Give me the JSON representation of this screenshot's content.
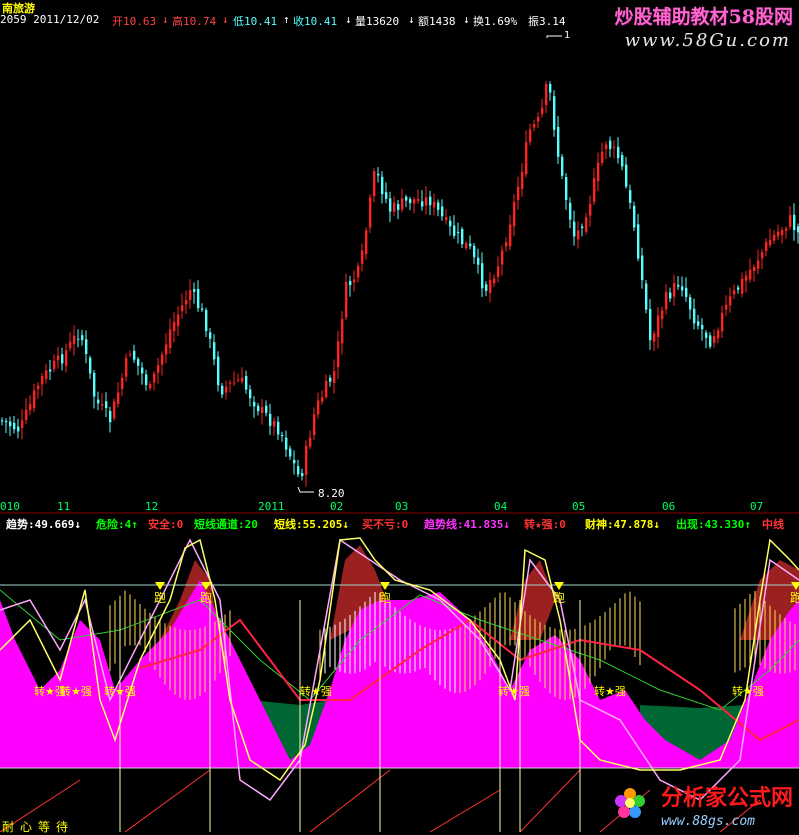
{
  "header": {
    "stock_name": "南旅游",
    "code_date": "2059 2011/12/02",
    "open": "开10.63",
    "open_arrow": "↓",
    "high": "高10.74",
    "high_arrow": "↓",
    "low": "低10.41",
    "low_arrow": "↑",
    "close": "收10.41",
    "close_arrow": "↓",
    "volume": "量13620",
    "volume_arrow": "↓",
    "amount": "额1438",
    "amount_arrow": "↓",
    "turnover": "换1.69%",
    "amplitude": "振3.14"
  },
  "watermark": {
    "title": "炒股辅助教材58股网",
    "url": "www.58Gu.com"
  },
  "price_labels": {
    "high_marker": "1",
    "low_marker": "8.20"
  },
  "x_axis": {
    "labels": [
      "010",
      "11",
      "12",
      "2011",
      "02",
      "03",
      "04",
      "05",
      "06",
      "07"
    ]
  },
  "indicators": [
    {
      "label": "趋势:49.669",
      "arrow": "↓",
      "color": "#ffffff"
    },
    {
      "label": "危险:4",
      "arrow": "↑",
      "color": "#00ff00"
    },
    {
      "label": "安全:0",
      "arrow": "",
      "color": "#ff3333"
    },
    {
      "label": "短线通道:20",
      "arrow": "",
      "color": "#00ff00"
    },
    {
      "label": "短线:55.205",
      "arrow": "↓",
      "color": "#ffff00"
    },
    {
      "label": "买不亏:0",
      "arrow": "",
      "color": "#ff3333"
    },
    {
      "label": "趋势线:41.835",
      "arrow": "↓",
      "color": "#ff33ff"
    },
    {
      "label": "转★强:0",
      "arrow": "",
      "color": "#ff3333"
    },
    {
      "label": "财神:47.878",
      "arrow": "↓",
      "color": "#ffff00"
    },
    {
      "label": "出现:43.330",
      "arrow": "↑",
      "color": "#00ff00"
    },
    {
      "label": "中线",
      "arrow": "",
      "color": "#ff3333"
    }
  ],
  "signals": {
    "run": "跑",
    "turn_strong": "转★强",
    "wait_text": "耐心等待"
  },
  "footer": {
    "logo": "分析家公式网",
    "url": "www.88gs.com"
  },
  "colors": {
    "up_candle": "#ff2222",
    "down_candle": "#54ffff",
    "magenta_fill": "#ff00ff",
    "dark_red_fill": "#9b2020",
    "green_fill": "#006633",
    "yellow_line": "#ffff66"
  }
}
